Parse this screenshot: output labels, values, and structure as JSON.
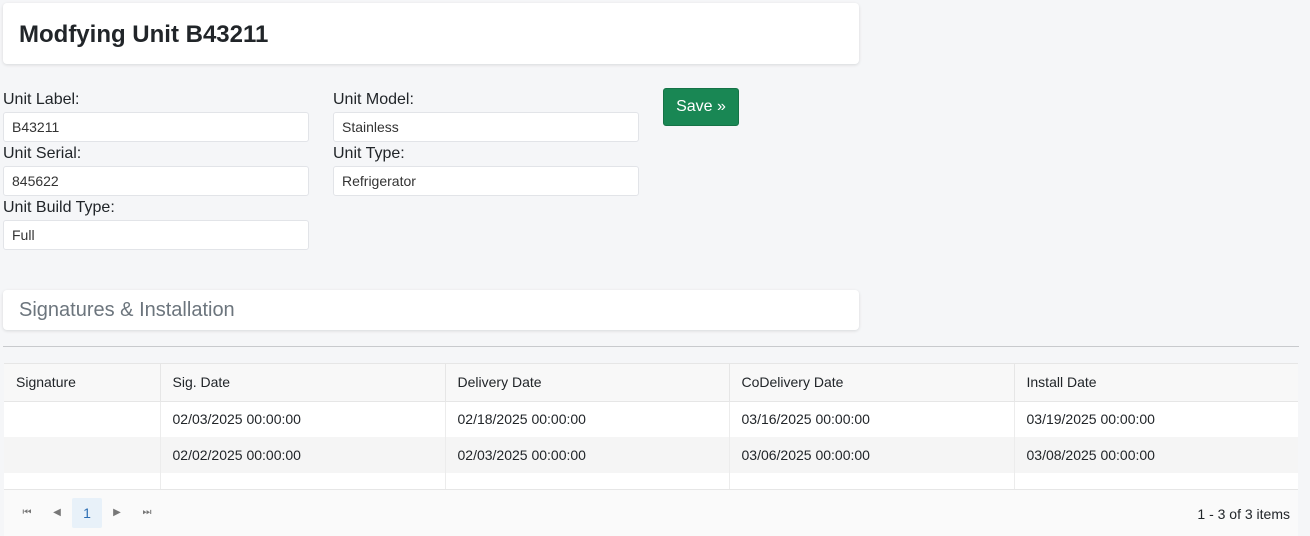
{
  "header": {
    "title": "Modfying Unit B43211"
  },
  "form": {
    "unit_label": {
      "label": "Unit Label:",
      "value": "B43211"
    },
    "unit_model": {
      "label": "Unit Model:",
      "value": "Stainless"
    },
    "unit_serial": {
      "label": "Unit Serial:",
      "value": "845622"
    },
    "unit_type": {
      "label": "Unit Type:",
      "value": "Refrigerator"
    },
    "unit_build_type": {
      "label": "Unit Build Type:",
      "value": "Full"
    },
    "save_label": "Save »"
  },
  "section": {
    "title": "Signatures & Installation"
  },
  "grid": {
    "columns": [
      "Signature",
      "Sig. Date",
      "Delivery Date",
      "CoDelivery Date",
      "Install Date"
    ],
    "rows": [
      [
        "",
        "02/03/2025 00:00:00",
        "02/18/2025 00:00:00",
        "03/16/2025 00:00:00",
        "03/19/2025 00:00:00"
      ],
      [
        "",
        "02/02/2025 00:00:00",
        "02/03/2025 00:00:00",
        "03/06/2025 00:00:00",
        "03/08/2025 00:00:00"
      ]
    ],
    "pager": {
      "first_icon": "first-page-icon",
      "prev_icon": "prev-page-icon",
      "next_icon": "next-page-icon",
      "last_icon": "last-page-icon",
      "current_page": "1",
      "info": "1 - 3 of 3 items"
    }
  },
  "colors": {
    "save": "#198754",
    "page_active": "#e8f1f9"
  }
}
